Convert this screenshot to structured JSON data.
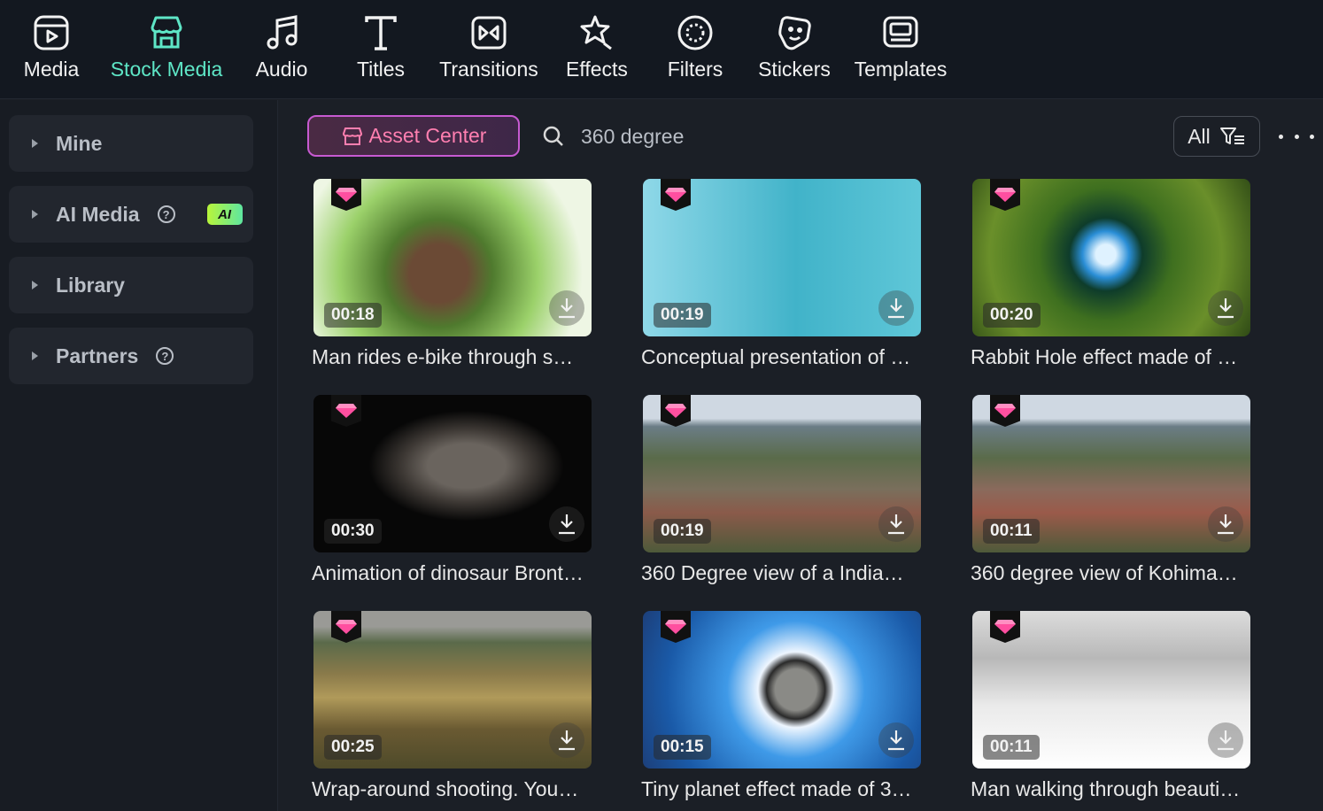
{
  "toolbar": {
    "tabs": [
      {
        "label": "Media",
        "icon": "media-icon"
      },
      {
        "label": "Stock Media",
        "icon": "stock-store-icon",
        "active": true
      },
      {
        "label": "Audio",
        "icon": "music-note-icon"
      },
      {
        "label": "Titles",
        "icon": "title-t-icon"
      },
      {
        "label": "Transitions",
        "icon": "transitions-icon"
      },
      {
        "label": "Effects",
        "icon": "effects-star-icon"
      },
      {
        "label": "Filters",
        "icon": "filters-icon"
      },
      {
        "label": "Stickers",
        "icon": "sticker-icon"
      },
      {
        "label": "Templates",
        "icon": "templates-icon"
      }
    ],
    "accent_color": "#5ee6c6"
  },
  "sidebar": {
    "items": [
      {
        "label": "Mine"
      },
      {
        "label": "AI Media",
        "badge": "AI",
        "help": "?"
      },
      {
        "label": "Library"
      },
      {
        "label": "Partners",
        "help": "?"
      }
    ]
  },
  "search": {
    "asset_center_label": "Asset Center",
    "query": "360 degree",
    "filter_label": "All"
  },
  "grid": {
    "items": [
      {
        "duration": "00:18",
        "title": "Man rides e-bike through s…"
      },
      {
        "duration": "00:19",
        "title": "Conceptual presentation of …"
      },
      {
        "duration": "00:20",
        "title": "Rabbit Hole effect made of …"
      },
      {
        "duration": "00:30",
        "title": "Animation of dinosaur Bront…"
      },
      {
        "duration": "00:19",
        "title": "360 Degree view of a India…"
      },
      {
        "duration": "00:11",
        "title": "360 degree view of Kohima…"
      },
      {
        "duration": "00:25",
        "title": "Wrap-around shooting. You…"
      },
      {
        "duration": "00:15",
        "title": "Tiny planet effect made of 3…"
      },
      {
        "duration": "00:11",
        "title": "Man walking through beauti…"
      }
    ]
  }
}
